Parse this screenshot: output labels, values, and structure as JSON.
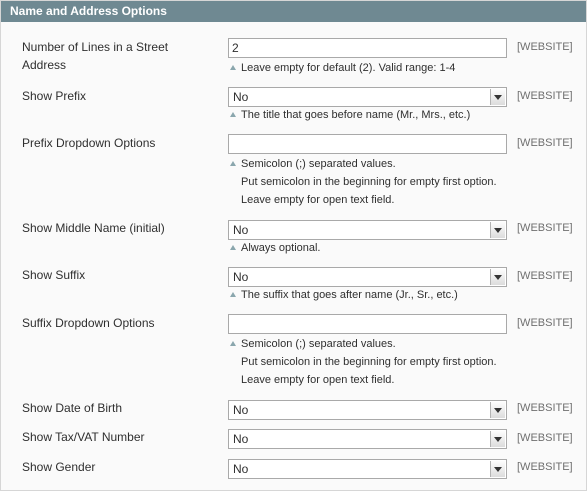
{
  "title": "Name and Address Options",
  "scope_label": "[WEBSITE]",
  "rows": {
    "street_lines": {
      "label_1": "Number of Lines in a Street",
      "label_2": "Address",
      "value": "2",
      "notes": [
        "Leave empty for default (2). Valid range: 1-4"
      ]
    },
    "show_prefix": {
      "label": "Show Prefix",
      "value": "No",
      "notes": [
        "The title that goes before name (Mr., Mrs., etc.)"
      ]
    },
    "prefix_options": {
      "label": "Prefix Dropdown Options",
      "value": "",
      "notes": [
        "Semicolon (;) separated values.",
        "Put semicolon in the beginning for empty first option.",
        "Leave empty for open text field."
      ]
    },
    "show_middle_name": {
      "label": "Show Middle Name (initial)",
      "value": "No",
      "notes": [
        "Always optional."
      ]
    },
    "show_suffix": {
      "label": "Show Suffix",
      "value": "No",
      "notes": [
        "The suffix that goes after name (Jr., Sr., etc.)"
      ]
    },
    "suffix_options": {
      "label": "Suffix Dropdown Options",
      "value": "",
      "notes": [
        "Semicolon (;) separated values.",
        "Put semicolon in the beginning for empty first option.",
        "Leave empty for open text field."
      ]
    },
    "show_dob": {
      "label": "Show Date of Birth",
      "value": "No"
    },
    "show_taxvat": {
      "label": "Show Tax/VAT Number",
      "value": "No"
    },
    "show_gender": {
      "label": "Show Gender",
      "value": "No"
    }
  },
  "icons": {
    "note_marker": "triangle-up-icon",
    "dropdown": "chevron-down-icon"
  },
  "colors": {
    "header_bg": "#6f8992",
    "header_text": "#ffffff",
    "scope_text": "#6f6f6f"
  }
}
